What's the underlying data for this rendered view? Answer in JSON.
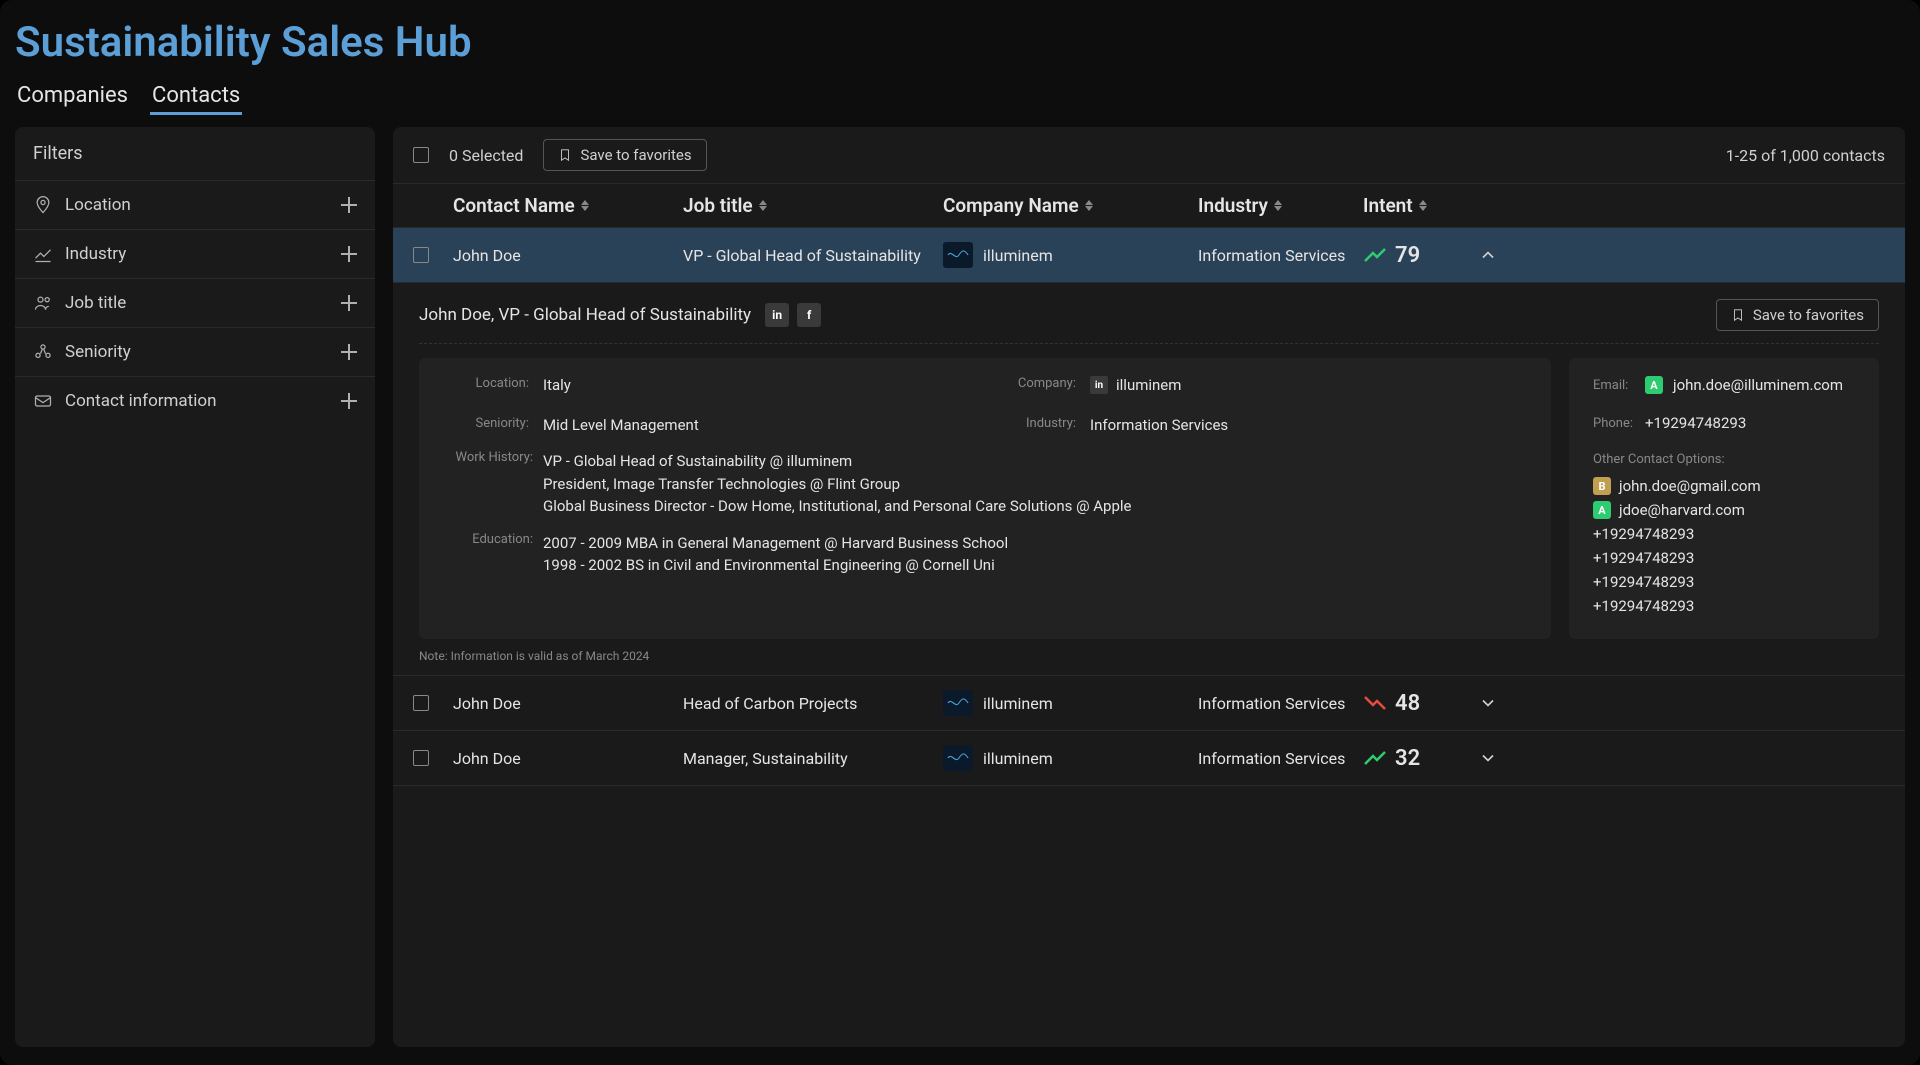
{
  "title": "Sustainability Sales Hub",
  "tabs": {
    "companies": "Companies",
    "contacts": "Contacts"
  },
  "filters": {
    "header": "Filters",
    "items": [
      {
        "label": "Location"
      },
      {
        "label": "Industry"
      },
      {
        "label": "Job title"
      },
      {
        "label": "Seniority"
      },
      {
        "label": "Contact information"
      }
    ]
  },
  "toolbar": {
    "selected": "0 Selected",
    "save": "Save to favorites",
    "pagination": "1-25 of 1,000 contacts"
  },
  "columns": {
    "name": "Contact Name",
    "title": "Job title",
    "company": "Company Name",
    "industry": "Industry",
    "intent": "Intent"
  },
  "rows": [
    {
      "name": "John Doe",
      "title": "VP - Global Head of Sustainability",
      "company": "illuminem",
      "industry": "Information Services",
      "intent": "79",
      "trend": "up"
    },
    {
      "name": "John Doe",
      "title": "Head of Carbon Projects",
      "company": "illuminem",
      "industry": "Information Services",
      "intent": "48",
      "trend": "down"
    },
    {
      "name": "John Doe",
      "title": "Manager, Sustainability",
      "company": "illuminem",
      "industry": "Information Services",
      "intent": "32",
      "trend": "up"
    }
  ],
  "detail": {
    "heading": "John Doe, VP - Global Head of Sustainability",
    "save": "Save to favorites",
    "labels": {
      "location": "Location:",
      "company": "Company:",
      "seniority": "Seniority:",
      "industry": "Industry:",
      "work": "Work History:",
      "education": "Education:",
      "email": "Email:",
      "phone": "Phone:",
      "other": "Other Contact Options:"
    },
    "location": "Italy",
    "company": "illuminem",
    "seniority": "Mid Level Management",
    "industry": "Information Services",
    "work": [
      "VP - Global Head of Sustainability @ illuminem",
      "President, Image Transfer Technologies @ Flint Group",
      "Global Business Director - Dow Home, Institutional, and Personal Care Solutions @ Apple"
    ],
    "education": [
      "2007 - 2009 MBA in General Management @ Harvard Business School",
      "1998 - 2002 BS in Civil and Environmental Engineering @ Cornell Uni"
    ],
    "note": "Note: Information is valid as of March 2024",
    "email": "john.doe@illuminem.com",
    "phone": "+19294748293",
    "other_emails": [
      {
        "grade": "B",
        "value": "john.doe@gmail.com"
      },
      {
        "grade": "A",
        "value": "jdoe@harvard.com"
      }
    ],
    "other_phones": [
      "+19294748293",
      "+19294748293",
      "+19294748293",
      "+19294748293"
    ]
  }
}
